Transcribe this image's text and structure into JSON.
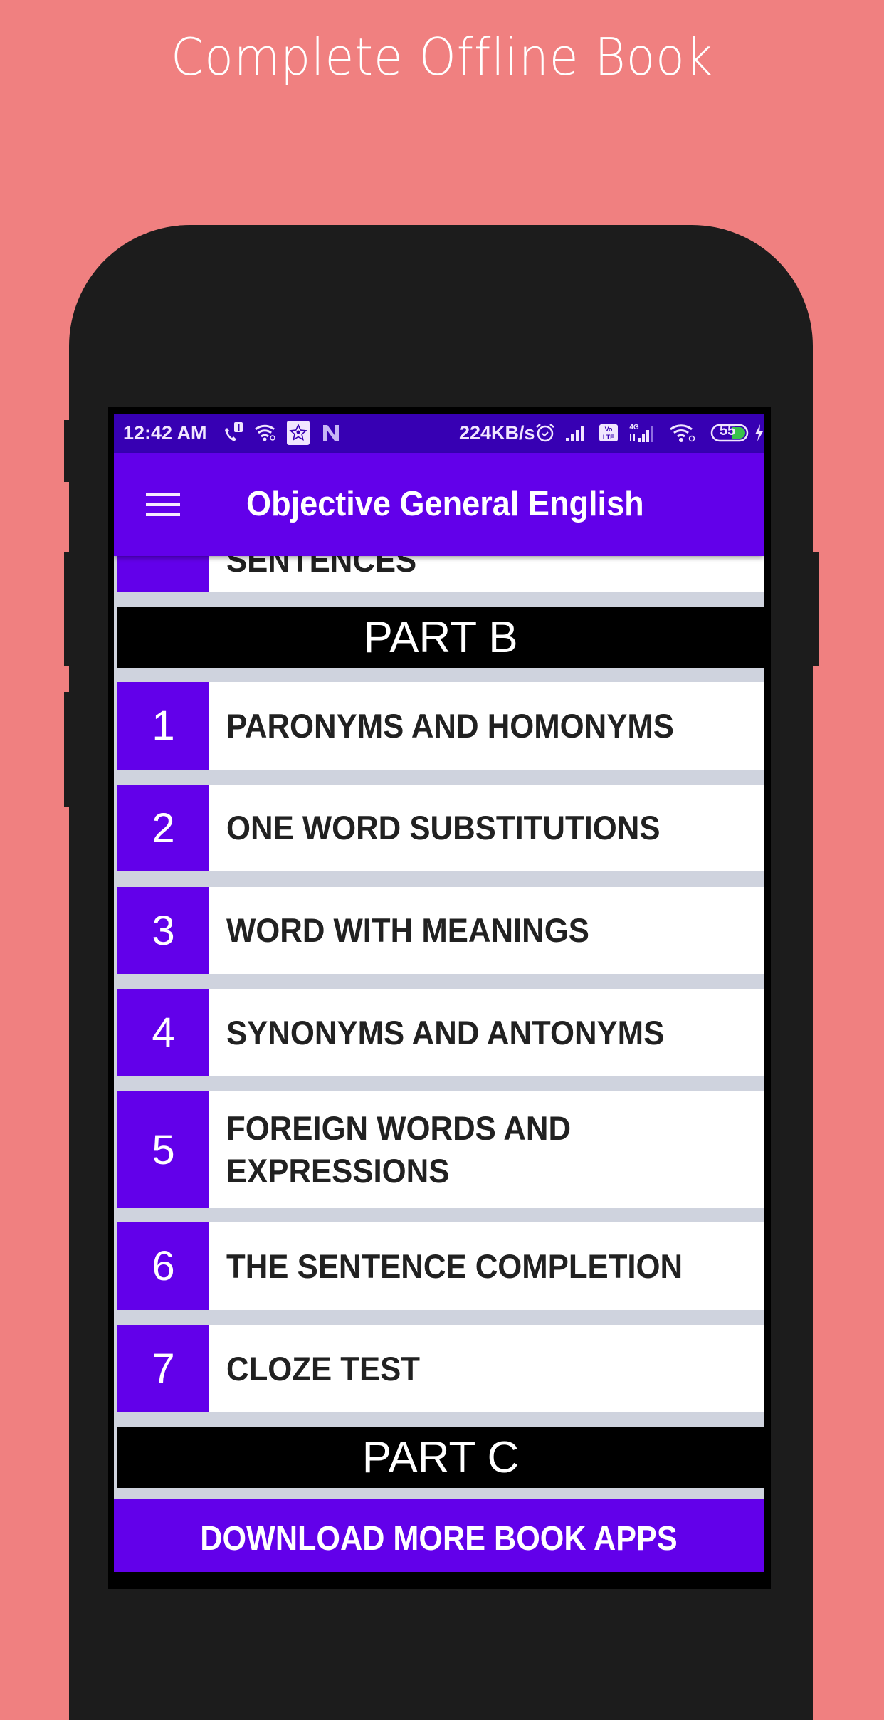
{
  "promo": {
    "title": "Complete Offline Book"
  },
  "status_bar": {
    "time": "12:42 AM",
    "net_speed": "224KB/s",
    "battery_level": "55",
    "network_label": "4G",
    "volte_label": "Vo LTE",
    "left_icons": [
      "call-alert-icon",
      "wifi-link-icon",
      "star-app-icon",
      "n-app-icon"
    ],
    "right_icons": [
      "alarm-icon",
      "signal-icon",
      "volte-icon",
      "signal-4g-icon",
      "wifi-icon",
      "battery-icon",
      "charging-icon"
    ]
  },
  "toolbar": {
    "title": "Objective General English",
    "menu_icon": "hamburger-menu-icon"
  },
  "list": {
    "partial_item": {
      "label": "SENTENCES"
    },
    "section_b": "PART B",
    "items": [
      {
        "num": "1",
        "label": "PARONYMS AND HOMONYMS"
      },
      {
        "num": "2",
        "label": "ONE WORD SUBSTITUTIONS"
      },
      {
        "num": "3",
        "label": "WORD WITH MEANINGS"
      },
      {
        "num": "4",
        "label": "SYNONYMS AND ANTONYMS"
      },
      {
        "num": "5",
        "label": "FOREIGN WORDS AND EXPRESSIONS"
      },
      {
        "num": "6",
        "label": "THE SENTENCE COMPLETION"
      },
      {
        "num": "7",
        "label": "CLOZE TEST"
      }
    ],
    "section_c": "PART C"
  },
  "footer": {
    "download_label": "DOWNLOAD MORE BOOK APPS"
  },
  "colors": {
    "background": "#f08080",
    "status_bar": "#3700b3",
    "primary": "#6200ea",
    "list_gap": "#cfd3de",
    "text": "#212121"
  }
}
